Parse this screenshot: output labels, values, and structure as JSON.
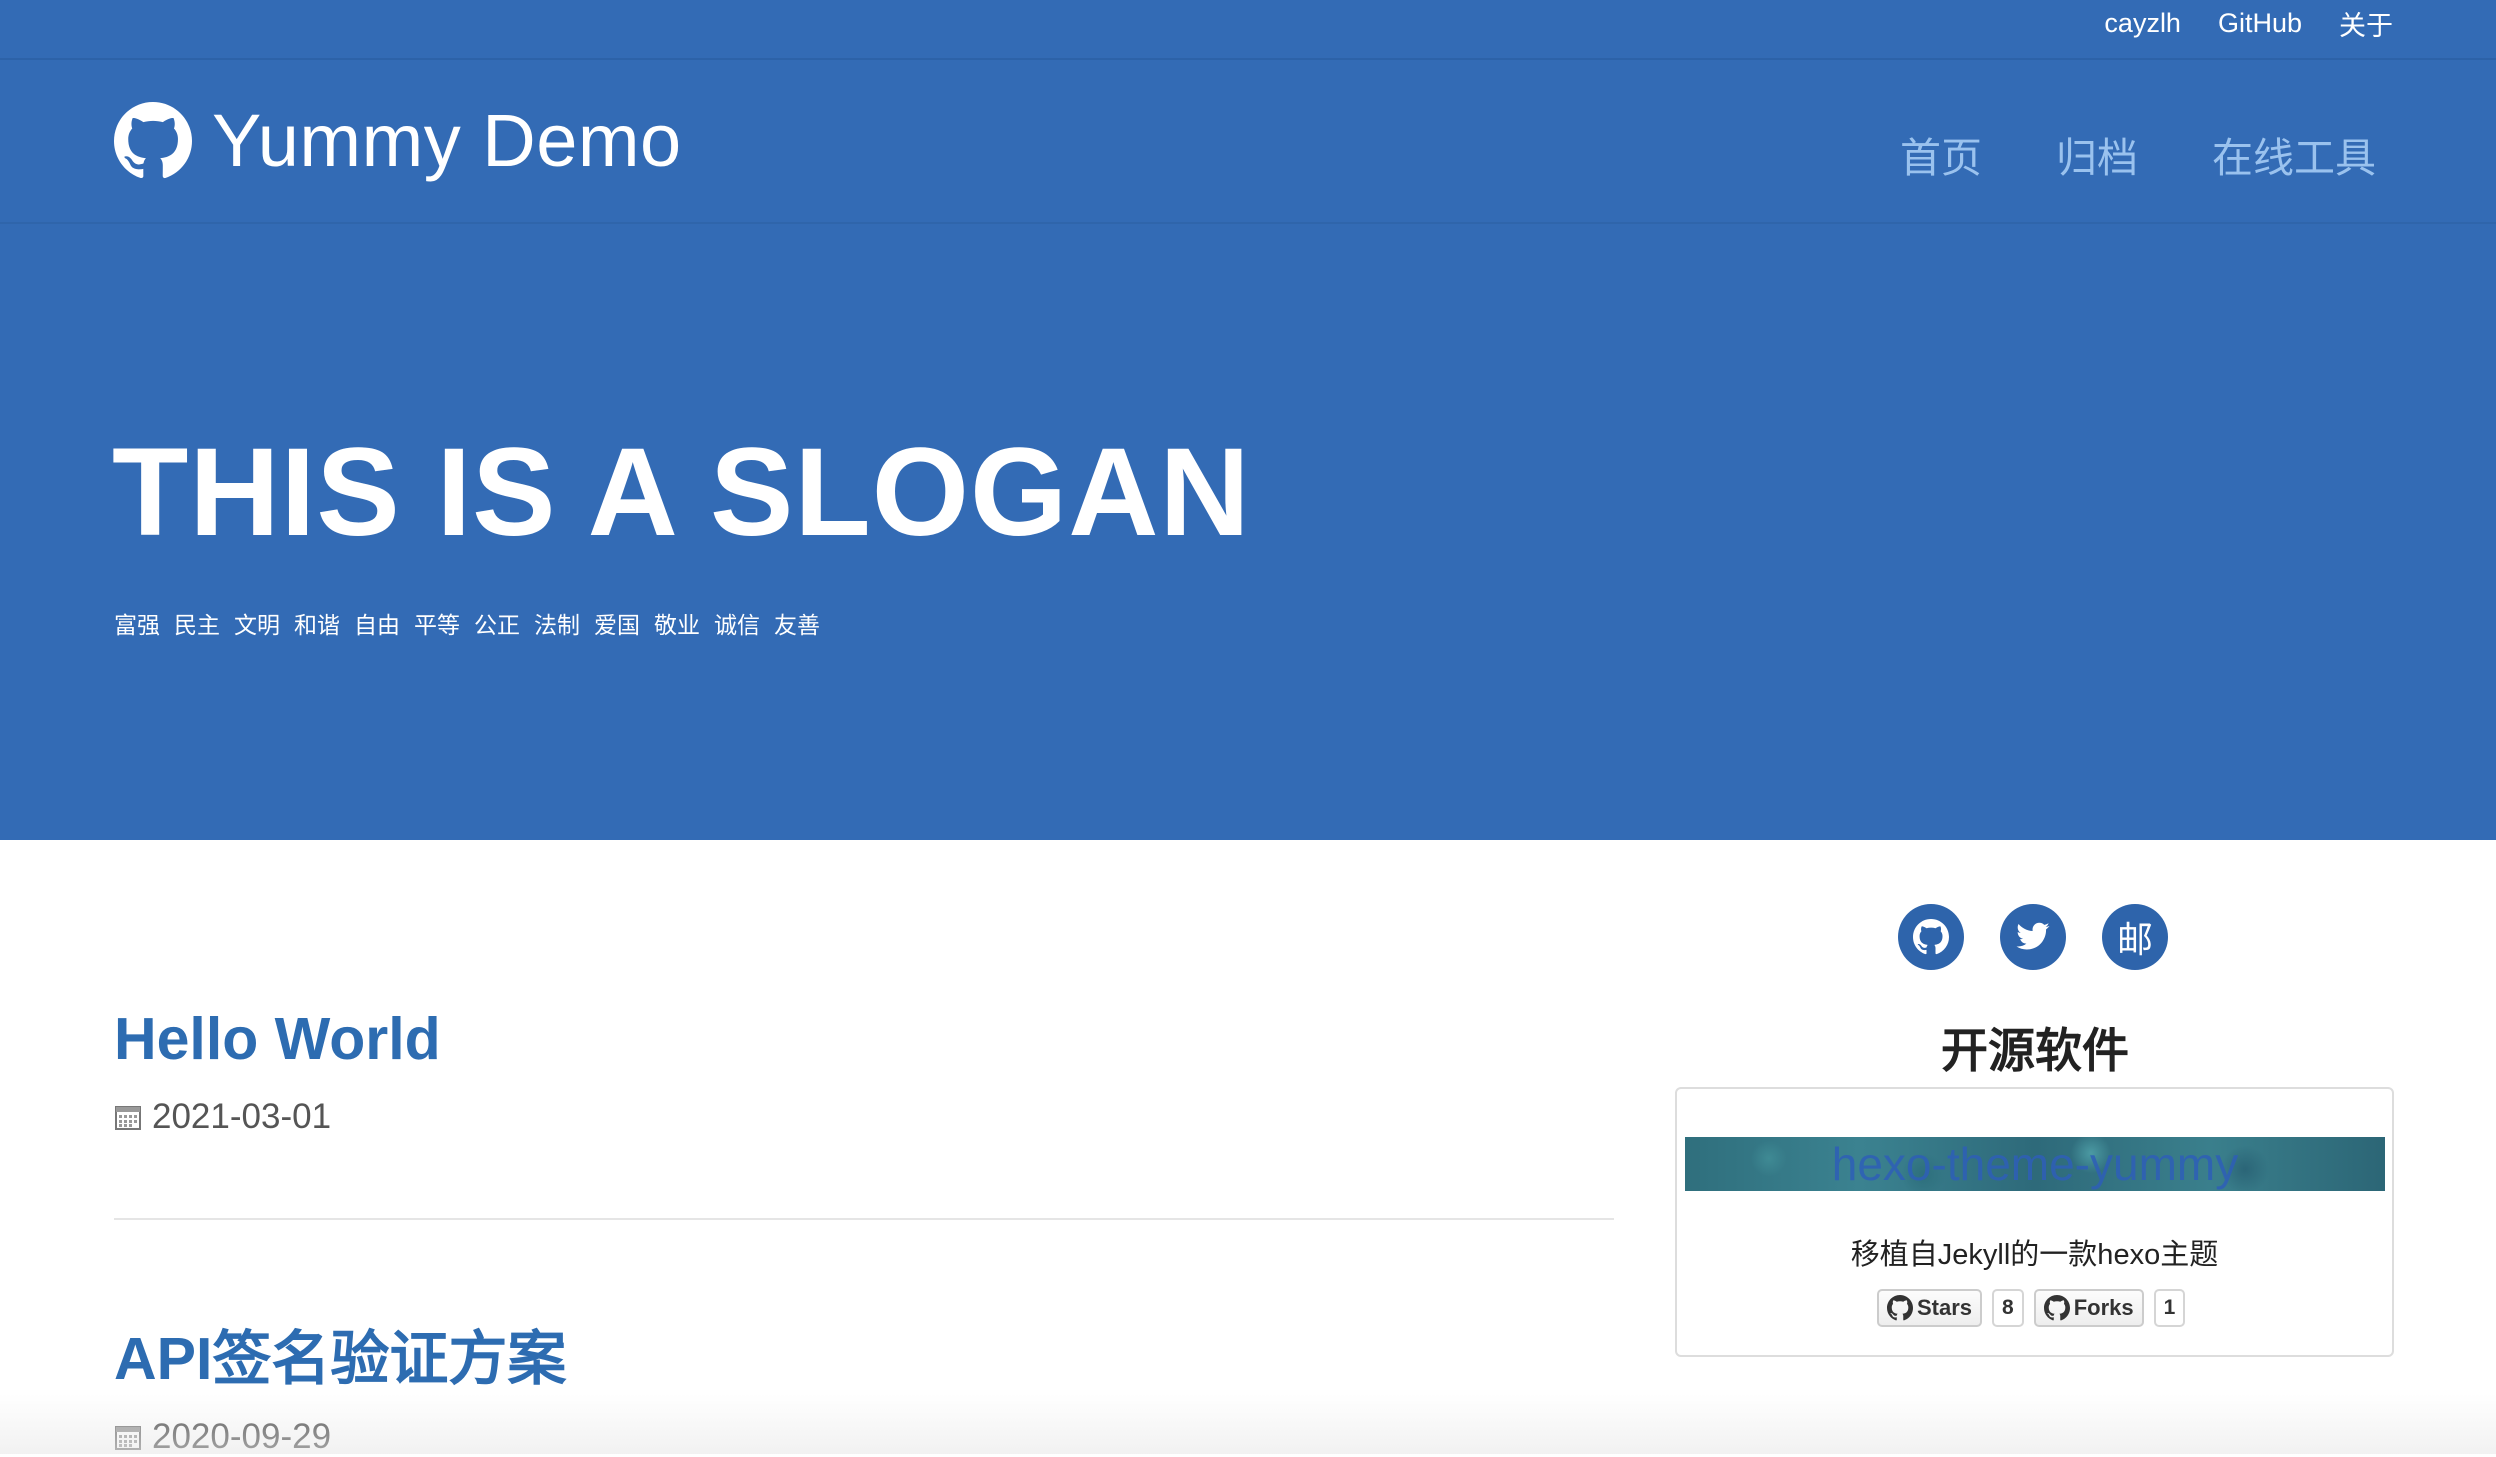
{
  "topbar": {
    "links": [
      "cayzlh",
      "GitHub",
      "关于"
    ]
  },
  "navbar": {
    "brand": "Yummy Demo",
    "links": [
      "首页",
      "归档",
      "在线工具"
    ]
  },
  "hero": {
    "slogan": "THIS IS A SLOGAN",
    "values": [
      "富强",
      "民主",
      "文明",
      "和谐",
      "自由",
      "平等",
      "公正",
      "法制",
      "爱国",
      "敬业",
      "诚信",
      "友善"
    ]
  },
  "posts": [
    {
      "title": "Hello World",
      "date": "2021-03-01"
    },
    {
      "title": "API签名验证方案",
      "date": "2020-09-29"
    }
  ],
  "sidebar": {
    "social": [
      "github-icon",
      "twitter-icon",
      "邮"
    ],
    "oss_title": "开源软件",
    "repo": {
      "name": "hexo-theme-yummy",
      "description": "移植自Jekyll的一款hexo主题",
      "stars_label": "Stars",
      "stars_count": "8",
      "forks_label": "Forks",
      "forks_count": "1"
    }
  },
  "colors": {
    "primary": "#336bb5",
    "link": "#2d6cb1",
    "nav_link": "#9ac2ee"
  }
}
